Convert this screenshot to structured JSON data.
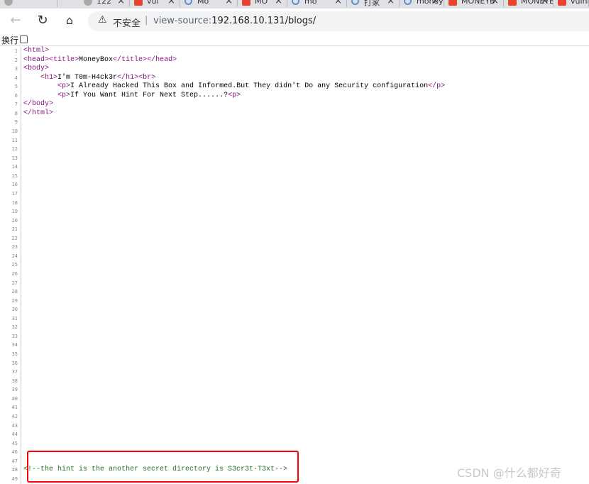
{
  "tabs": [
    {
      "title": "122",
      "icon": "gray"
    },
    {
      "title": "vul",
      "icon": "csdn"
    },
    {
      "title": "Mo",
      "icon": "search"
    },
    {
      "title": "MO",
      "icon": "csdn"
    },
    {
      "title": "mo",
      "icon": "search"
    },
    {
      "title": "打家",
      "icon": "search"
    },
    {
      "title": "moneyb",
      "icon": "search"
    },
    {
      "title": "MONEYB",
      "icon": "csdn"
    },
    {
      "title": "MONEYB",
      "icon": "csdn"
    },
    {
      "title": "vulnh",
      "icon": "csdn"
    }
  ],
  "address_bar": {
    "security_label": "不安全",
    "url_prefix": "view-source:",
    "url_host": "192.168.10.131/blogs/"
  },
  "wrap_toggle": {
    "label": "换行",
    "checked": false
  },
  "line_count": 49,
  "source_lines": [
    {
      "line": 1,
      "indent": "",
      "parts": [
        {
          "t": "tag",
          "v": "<html>"
        }
      ]
    },
    {
      "line": 2,
      "indent": "",
      "parts": [
        {
          "t": "tag",
          "v": "<head>"
        },
        {
          "t": "tag",
          "v": "<title>"
        },
        {
          "t": "text",
          "v": "MoneyBox"
        },
        {
          "t": "tag",
          "v": "</title>"
        },
        {
          "t": "tag",
          "v": "</head>"
        }
      ]
    },
    {
      "line": 3,
      "indent": "",
      "parts": [
        {
          "t": "tag",
          "v": "<body>"
        }
      ]
    },
    {
      "line": 4,
      "indent": "    ",
      "parts": [
        {
          "t": "tag",
          "v": "<h1>"
        },
        {
          "t": "text",
          "v": "I'm T0m-H4ck3r"
        },
        {
          "t": "tag",
          "v": "</h1>"
        },
        {
          "t": "tag",
          "v": "<br>"
        }
      ]
    },
    {
      "line": 5,
      "indent": "        ",
      "parts": [
        {
          "t": "tag",
          "v": "<p>"
        },
        {
          "t": "text",
          "v": "I Already Hacked This Box and Informed.But They didn't Do any Security configuration"
        },
        {
          "t": "tag",
          "v": "</p>"
        }
      ]
    },
    {
      "line": 6,
      "indent": "        ",
      "parts": [
        {
          "t": "tag",
          "v": "<p>"
        },
        {
          "t": "text",
          "v": "If You Want Hint For Next Step......?"
        },
        {
          "t": "tag",
          "v": "<p>"
        }
      ]
    },
    {
      "line": 7,
      "indent": "",
      "parts": [
        {
          "t": "tag",
          "v": "</body>"
        }
      ]
    },
    {
      "line": 8,
      "indent": "",
      "parts": [
        {
          "t": "tag",
          "v": "</html>"
        }
      ]
    },
    {
      "line": 48,
      "indent": "",
      "parts": [
        {
          "t": "cmt",
          "v": "<!--the hint is the another secret directory is S3cr3t-T3xt-->"
        }
      ]
    }
  ],
  "watermark": "CSDN @什么都好奇"
}
